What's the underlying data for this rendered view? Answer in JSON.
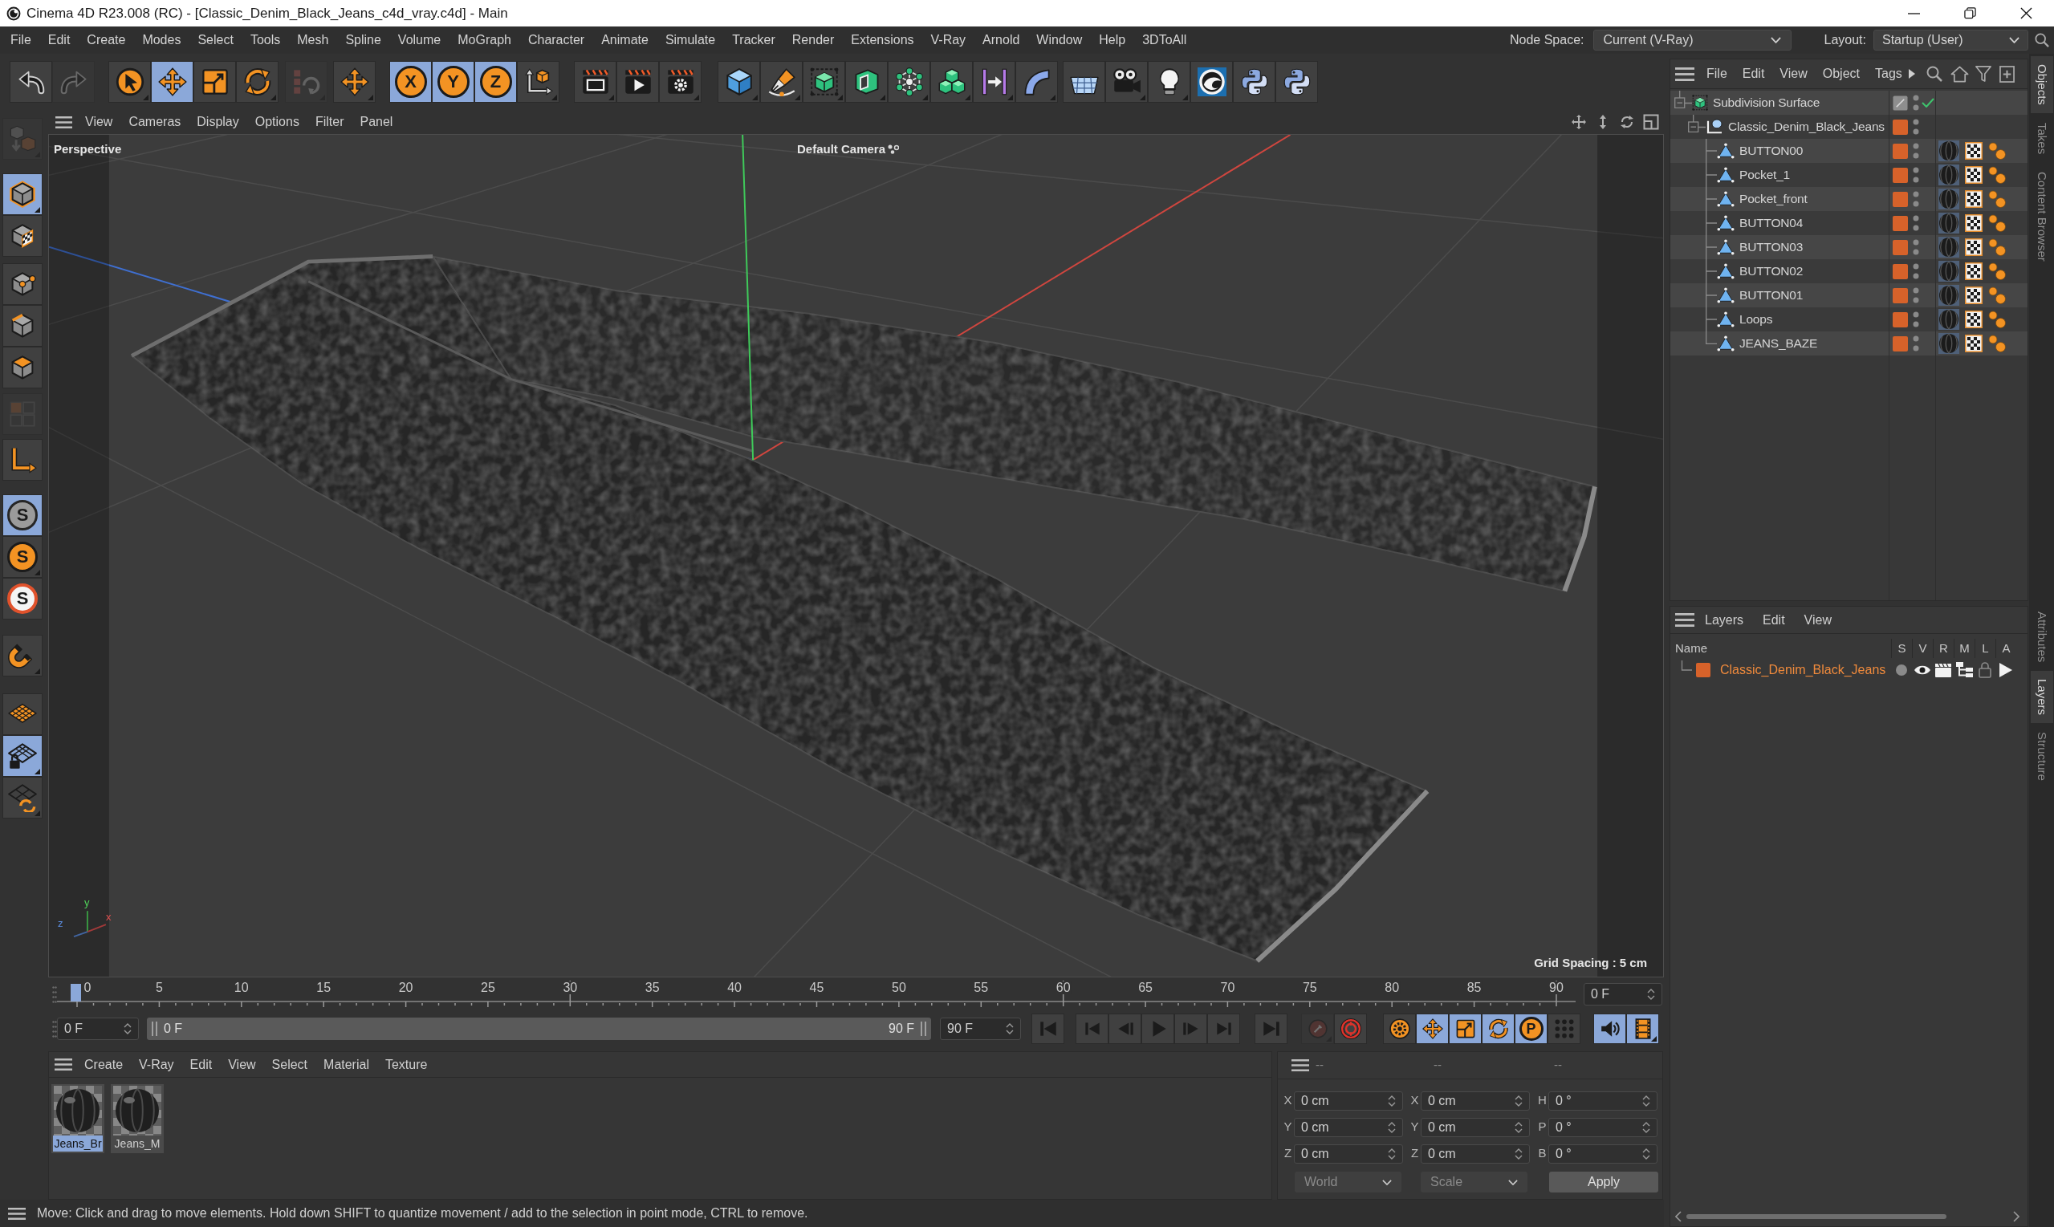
{
  "window": {
    "title": "Cinema 4D R23.008 (RC) - [Classic_Denim_Black_Jeans_c4d_vray.c4d] - Main"
  },
  "menu_bar": {
    "items": [
      "File",
      "Edit",
      "Create",
      "Modes",
      "Select",
      "Tools",
      "Mesh",
      "Spline",
      "Volume",
      "MoGraph",
      "Character",
      "Animate",
      "Simulate",
      "Tracker",
      "Render",
      "Extensions",
      "V-Ray",
      "Arnold",
      "Window",
      "Help",
      "3DToAll"
    ],
    "node_space": {
      "label": "Node Space:",
      "value": "Current (V-Ray)"
    },
    "layout": {
      "label": "Layout:",
      "value": "Startup (User)"
    }
  },
  "main_toolbar": [
    [
      {
        "selected": false,
        "disabled": false
      },
      {
        "selected": false,
        "disabled": true
      }
    ],
    [
      {
        "selected": false,
        "disabled": false
      },
      {
        "selected": true,
        "disabled": false
      },
      {
        "selected": false,
        "disabled": false
      },
      {
        "selected": false,
        "disabled": false
      }
    ],
    [
      {
        "selected": false,
        "disabled": true
      }
    ],
    [
      {
        "selected": false,
        "disabled": false
      }
    ],
    [
      {
        "label": "X",
        "selected": true,
        "disabled": false
      },
      {
        "label": "Y",
        "selected": true,
        "disabled": false
      },
      {
        "label": "Z",
        "selected": true,
        "disabled": false
      },
      {
        "selected": false,
        "disabled": false
      }
    ],
    [
      {
        "selected": false,
        "disabled": false
      },
      {
        "selected": false,
        "disabled": false
      },
      {
        "selected": false,
        "disabled": false
      }
    ],
    [
      {
        "selected": false,
        "disabled": false
      },
      {
        "selected": false,
        "disabled": false
      },
      {
        "selected": false,
        "disabled": false
      },
      {
        "selected": false,
        "disabled": false
      },
      {
        "selected": false,
        "disabled": false
      },
      {
        "selected": false,
        "disabled": false
      },
      {
        "selected": false,
        "disabled": false
      },
      {
        "selected": false,
        "disabled": false
      }
    ],
    [
      {
        "selected": false,
        "disabled": false
      },
      {
        "selected": false,
        "disabled": false
      },
      {
        "selected": false,
        "disabled": false
      },
      {
        "selected": false,
        "disabled": false
      },
      {
        "selected": false,
        "disabled": false
      },
      {
        "selected": false,
        "disabled": false
      }
    ]
  ],
  "tool_palette": [
    [
      {
        "selected": false,
        "disabled": true
      }
    ],
    [
      {
        "selected": true,
        "disabled": false
      },
      {
        "selected": false,
        "disabled": false
      }
    ],
    [
      {
        "selected": false,
        "disabled": false
      },
      {
        "selected": false,
        "disabled": false
      },
      {
        "selected": false,
        "disabled": false
      }
    ],
    [
      {
        "selected": false,
        "disabled": true
      }
    ],
    [
      {
        "selected": false,
        "disabled": false
      }
    ],
    [
      {
        "label": "S",
        "selected": true,
        "disabled": false
      },
      {
        "label": "S",
        "selected": false,
        "disabled": false
      },
      {
        "label": "S",
        "selected": false,
        "disabled": false
      }
    ],
    [
      {
        "selected": false,
        "disabled": false
      }
    ],
    [
      {
        "selected": false,
        "disabled": false
      },
      {
        "selected": true,
        "disabled": false
      },
      {
        "selected": false,
        "disabled": false
      }
    ]
  ],
  "viewport": {
    "menu": [
      "View",
      "Cameras",
      "Display",
      "Options",
      "Filter",
      "Panel"
    ],
    "view_name": "Perspective",
    "camera": "Default Camera",
    "grid_spacing": "Grid Spacing : 5 cm",
    "axis_labels": [
      "z",
      "y",
      "x"
    ]
  },
  "timeline": {
    "ticks": [
      "0",
      "5",
      "10",
      "15",
      "20",
      "25",
      "30",
      "35",
      "40",
      "45",
      "50",
      "55",
      "60",
      "65",
      "70",
      "75",
      "80",
      "85",
      "90"
    ],
    "playhead": {
      "level": 0
    },
    "current_frame": "0 F"
  },
  "playback": {
    "start_frame": "0 F",
    "range": {
      "start": "0 F",
      "end": "90 F",
      "level": 1
    },
    "end_frame": "90 F",
    "buttons": [
      [
        {
          "selected": false,
          "disabled": false
        }
      ],
      [
        {
          "selected": false,
          "disabled": false
        },
        {
          "selected": false,
          "disabled": false
        },
        {
          "selected": false,
          "disabled": false
        },
        {
          "selected": false,
          "disabled": false
        },
        {
          "selected": false,
          "disabled": false
        }
      ],
      [
        {
          "selected": false,
          "disabled": false
        }
      ],
      [
        {
          "selected": false,
          "disabled": true
        },
        {
          "selected": false,
          "disabled": false
        }
      ],
      [
        {
          "selected": false,
          "disabled": false
        },
        {
          "selected": true,
          "disabled": false
        },
        {
          "selected": true,
          "disabled": false
        },
        {
          "selected": true,
          "disabled": false
        },
        {
          "label": "P",
          "selected": true,
          "disabled": false
        },
        {
          "selected": false,
          "disabled": false
        }
      ],
      [
        {
          "selected": true,
          "disabled": false
        },
        {
          "selected": true,
          "disabled": false
        }
      ]
    ]
  },
  "material_manager": {
    "menu": [
      "Create",
      "V-Ray",
      "Edit",
      "View",
      "Select",
      "Material",
      "Texture"
    ],
    "materials": [
      {
        "name": "Jeans_Br",
        "selected": true
      },
      {
        "name": "Jeans_M",
        "selected": false
      }
    ]
  },
  "coordinates": {
    "columns": [
      {
        "header": "--",
        "fields": [
          {
            "label": "X",
            "value": "0 cm"
          },
          {
            "label": "Y",
            "value": "0 cm"
          },
          {
            "label": "Z",
            "value": "0 cm"
          }
        ]
      },
      {
        "header": "--",
        "fields": [
          {
            "label": "X",
            "value": "0 cm"
          },
          {
            "label": "Y",
            "value": "0 cm"
          },
          {
            "label": "Z",
            "value": "0 cm"
          }
        ]
      },
      {
        "header": "--",
        "fields": [
          {
            "label": "H",
            "value": "0 °"
          },
          {
            "label": "P",
            "value": "0 °"
          },
          {
            "label": "B",
            "value": "0 °"
          }
        ]
      }
    ],
    "dropdowns": [
      "World",
      "Scale"
    ],
    "apply": "Apply"
  },
  "status_bar": {
    "text": "Move: Click and drag to move elements. Hold down SHIFT to quantize movement / add to the selection in point mode, CTRL to remove."
  },
  "object_manager": {
    "menu": [
      "File",
      "Edit",
      "View",
      "Object",
      "Tags"
    ],
    "objects": [
      {
        "name": "Subdivision Surface",
        "kind": "generator",
        "layer": false,
        "enabled": true,
        "expanded": true,
        "children": [
          {
            "name": "Classic_Denim_Black_Jeans",
            "kind": "group",
            "layer": true,
            "expanded": true,
            "children": [
              {
                "name": "BUTTON00",
                "kind": "polygon",
                "layer": true,
                "tags": [
                  {
                    "kind": "material"
                  },
                  {
                    "kind": "uvw"
                  },
                  {
                    "kind": "phong"
                  }
                ]
              },
              {
                "name": "Pocket_1",
                "kind": "polygon",
                "layer": true,
                "tags": [
                  {
                    "kind": "material"
                  },
                  {
                    "kind": "uvw"
                  },
                  {
                    "kind": "phong"
                  }
                ]
              },
              {
                "name": "Pocket_front",
                "kind": "polygon",
                "layer": true,
                "tags": [
                  {
                    "kind": "material"
                  },
                  {
                    "kind": "uvw"
                  },
                  {
                    "kind": "phong"
                  }
                ]
              },
              {
                "name": "BUTTON04",
                "kind": "polygon",
                "layer": true,
                "tags": [
                  {
                    "kind": "material"
                  },
                  {
                    "kind": "uvw"
                  },
                  {
                    "kind": "phong"
                  }
                ]
              },
              {
                "name": "BUTTON03",
                "kind": "polygon",
                "layer": true,
                "tags": [
                  {
                    "kind": "material"
                  },
                  {
                    "kind": "uvw"
                  },
                  {
                    "kind": "phong"
                  }
                ]
              },
              {
                "name": "BUTTON02",
                "kind": "polygon",
                "layer": true,
                "tags": [
                  {
                    "kind": "material"
                  },
                  {
                    "kind": "uvw"
                  },
                  {
                    "kind": "phong"
                  }
                ]
              },
              {
                "name": "BUTTON01",
                "kind": "polygon",
                "layer": true,
                "tags": [
                  {
                    "kind": "material"
                  },
                  {
                    "kind": "uvw"
                  },
                  {
                    "kind": "phong"
                  }
                ]
              },
              {
                "name": "Loops",
                "kind": "polygon",
                "layer": true,
                "tags": [
                  {
                    "kind": "material"
                  },
                  {
                    "kind": "uvw"
                  },
                  {
                    "kind": "phong"
                  }
                ]
              },
              {
                "name": "JEANS_BAZE",
                "kind": "polygon",
                "layer": true,
                "tags": [
                  {
                    "kind": "material"
                  },
                  {
                    "kind": "uvw"
                  },
                  {
                    "kind": "phong"
                  }
                ]
              }
            ]
          }
        ]
      }
    ]
  },
  "layer_manager": {
    "menu": [
      "Layers",
      "Edit",
      "View"
    ],
    "columns": [
      "Name",
      "S",
      "V",
      "R",
      "M",
      "L",
      "A"
    ],
    "layers": [
      {
        "name": "Classic_Denim_Black_Jeans",
        "color": "#d7622a",
        "solo": false,
        "locked": false
      }
    ]
  },
  "side_tabs": {
    "top": [
      {
        "label": "Objects",
        "selected": true
      },
      {
        "label": "Takes",
        "selected": false
      },
      {
        "label": "Content Browser",
        "selected": false
      }
    ],
    "bottom": [
      {
        "label": "Attributes",
        "selected": false
      },
      {
        "label": "Layers",
        "selected": true
      },
      {
        "label": "Structure",
        "selected": false
      }
    ]
  }
}
